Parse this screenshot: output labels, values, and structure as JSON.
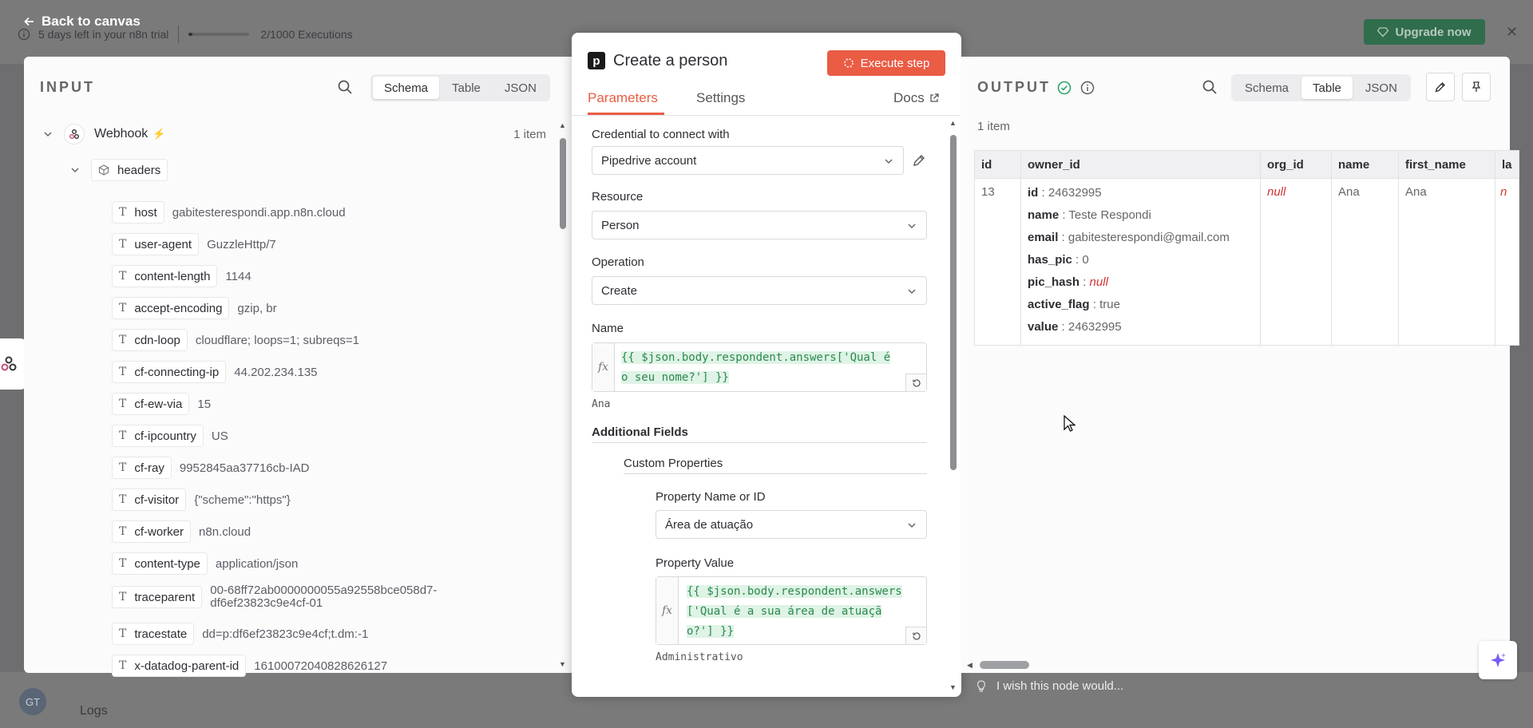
{
  "background": {
    "trial_text": "5 days left in your n8n trial",
    "executions_text": "2/1000 Executions",
    "executions_progress_fraction": 0.002,
    "upgrade_label": "Upgrade now",
    "back_label": "Back to canvas",
    "logs_label": "Logs",
    "avatar_initials": "GT"
  },
  "input": {
    "title": "INPUT",
    "tabs": [
      "Schema",
      "Table",
      "JSON"
    ],
    "active_tab": "Schema",
    "root_label": "Webhook",
    "root_count": "1 item",
    "group_label": "headers",
    "rows": [
      {
        "key": "host",
        "value": "gabitesterespondi.app.n8n.cloud"
      },
      {
        "key": "user-agent",
        "value": "GuzzleHttp/7"
      },
      {
        "key": "content-length",
        "value": "1144"
      },
      {
        "key": "accept-encoding",
        "value": "gzip, br"
      },
      {
        "key": "cdn-loop",
        "value": "cloudflare; loops=1; subreqs=1"
      },
      {
        "key": "cf-connecting-ip",
        "value": "44.202.234.135"
      },
      {
        "key": "cf-ew-via",
        "value": "15"
      },
      {
        "key": "cf-ipcountry",
        "value": "US"
      },
      {
        "key": "cf-ray",
        "value": "9952845aa37716cb-IAD"
      },
      {
        "key": "cf-visitor",
        "value": "{\"scheme\":\"https\"}"
      },
      {
        "key": "cf-worker",
        "value": "n8n.cloud"
      },
      {
        "key": "content-type",
        "value": "application/json"
      },
      {
        "key": "traceparent",
        "value": "00-68ff72ab0000000055a92558bce058d7-\ndf6ef23823c9e4cf-01"
      },
      {
        "key": "tracestate",
        "value": "dd=p:df6ef23823c9e4cf;t.dm:-1"
      },
      {
        "key": "x-datadog-parent-id",
        "value": "16100072040828626127"
      }
    ]
  },
  "node": {
    "title": "Create a person",
    "execute_label": "Execute step",
    "tabs": {
      "parameters": "Parameters",
      "settings": "Settings",
      "docs": "Docs"
    },
    "credential_label": "Credential to connect with",
    "credential_value": "Pipedrive account",
    "resource_label": "Resource",
    "resource_value": "Person",
    "operation_label": "Operation",
    "operation_value": "Create",
    "name_label": "Name",
    "name_expr_line1": "{{ $json.body.respondent.answers['Qual é",
    "name_expr_line2": "o seu nome?'] }}",
    "name_hint": "Ana",
    "additional_fields": "Additional Fields",
    "custom_properties": "Custom Properties",
    "prop_name_label": "Property Name or ID",
    "prop_name_value": "Área de atuação",
    "prop_value_label": "Property Value",
    "prop_expr_line1": "{{ $json.body.respondent.answers",
    "prop_expr_line2": "['Qual é a sua área de atuaçã",
    "prop_expr_line3": "o?'] }}",
    "prop_hint": "Administrativo"
  },
  "output": {
    "title": "OUTPUT",
    "tabs": [
      "Schema",
      "Table",
      "JSON"
    ],
    "active_tab": "Table",
    "count": "1 item",
    "columns": [
      "id",
      "owner_id",
      "org_id",
      "name",
      "first_name",
      "la"
    ],
    "row": {
      "id": "13",
      "owner": [
        {
          "k": "id",
          "v": "24632995"
        },
        {
          "k": "name",
          "v": "Teste Respondi"
        },
        {
          "k": "email",
          "v": "gabitesterespondi@gmail.com"
        },
        {
          "k": "has_pic",
          "v": "0"
        },
        {
          "k": "pic_hash",
          "v": "null"
        },
        {
          "k": "active_flag",
          "v": "true"
        },
        {
          "k": "value",
          "v": "24632995"
        }
      ],
      "org_id": "null",
      "name": "Ana",
      "first_name": "Ana",
      "last": "n"
    },
    "feedback": "I wish this node would..."
  },
  "colors": {
    "accent": "#ea5c44",
    "success": "#2fa36b",
    "expr_green": "#2b8a4e"
  }
}
